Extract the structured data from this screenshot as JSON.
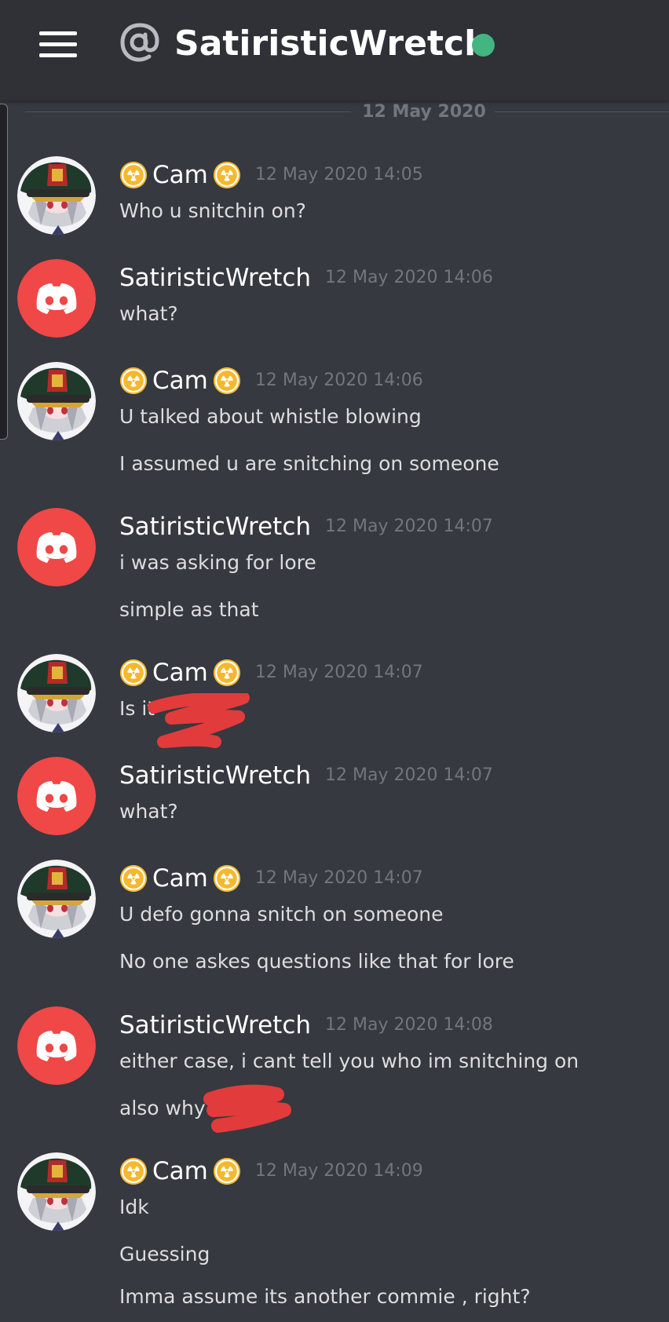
{
  "header": {
    "title": "SatiristicWretch",
    "status_color": "#43b581"
  },
  "divider": {
    "date": "12 May 2020"
  },
  "users": {
    "cam": {
      "name": "Cam",
      "badge_icon": "radioactive-icon",
      "avatar": "anime-officer-avatar"
    },
    "wretch": {
      "name": "SatiristicWretch",
      "avatar": "discord-default-avatar",
      "color": "#f04747"
    }
  },
  "messages": [
    {
      "author": "Cam",
      "timestamp": "12 May 2020 14:05",
      "lines": [
        "Who u snitchin on?"
      ]
    },
    {
      "author": "SatiristicWretch",
      "timestamp": "12 May 2020 14:06",
      "lines": [
        "what?"
      ]
    },
    {
      "author": "Cam",
      "timestamp": "12 May 2020 14:06",
      "lines": [
        "U talked about whistle blowing",
        "I assumed u are snitching on someone"
      ]
    },
    {
      "author": "SatiristicWretch",
      "timestamp": "12 May 2020 14:07",
      "lines": [
        "i was asking for lore",
        "simple as that"
      ]
    },
    {
      "author": "Cam",
      "timestamp": "12 May 2020 14:07",
      "lines": [
        "Is it"
      ]
    },
    {
      "author": "SatiristicWretch",
      "timestamp": "12 May 2020 14:07",
      "lines": [
        "what?"
      ]
    },
    {
      "author": "Cam",
      "timestamp": "12 May 2020 14:07",
      "lines": [
        "U defo gonna snitch on someone",
        "No one askes questions like that for lore"
      ]
    },
    {
      "author": "SatiristicWretch",
      "timestamp": "12 May 2020 14:08",
      "lines": [
        "either case, i cant tell you who im snitching on",
        "also why"
      ]
    },
    {
      "author": "Cam",
      "timestamp": "12 May 2020 14:09",
      "lines": [
        "Idk",
        "Guessing",
        "Imma assume its another commie , right?"
      ]
    }
  ]
}
